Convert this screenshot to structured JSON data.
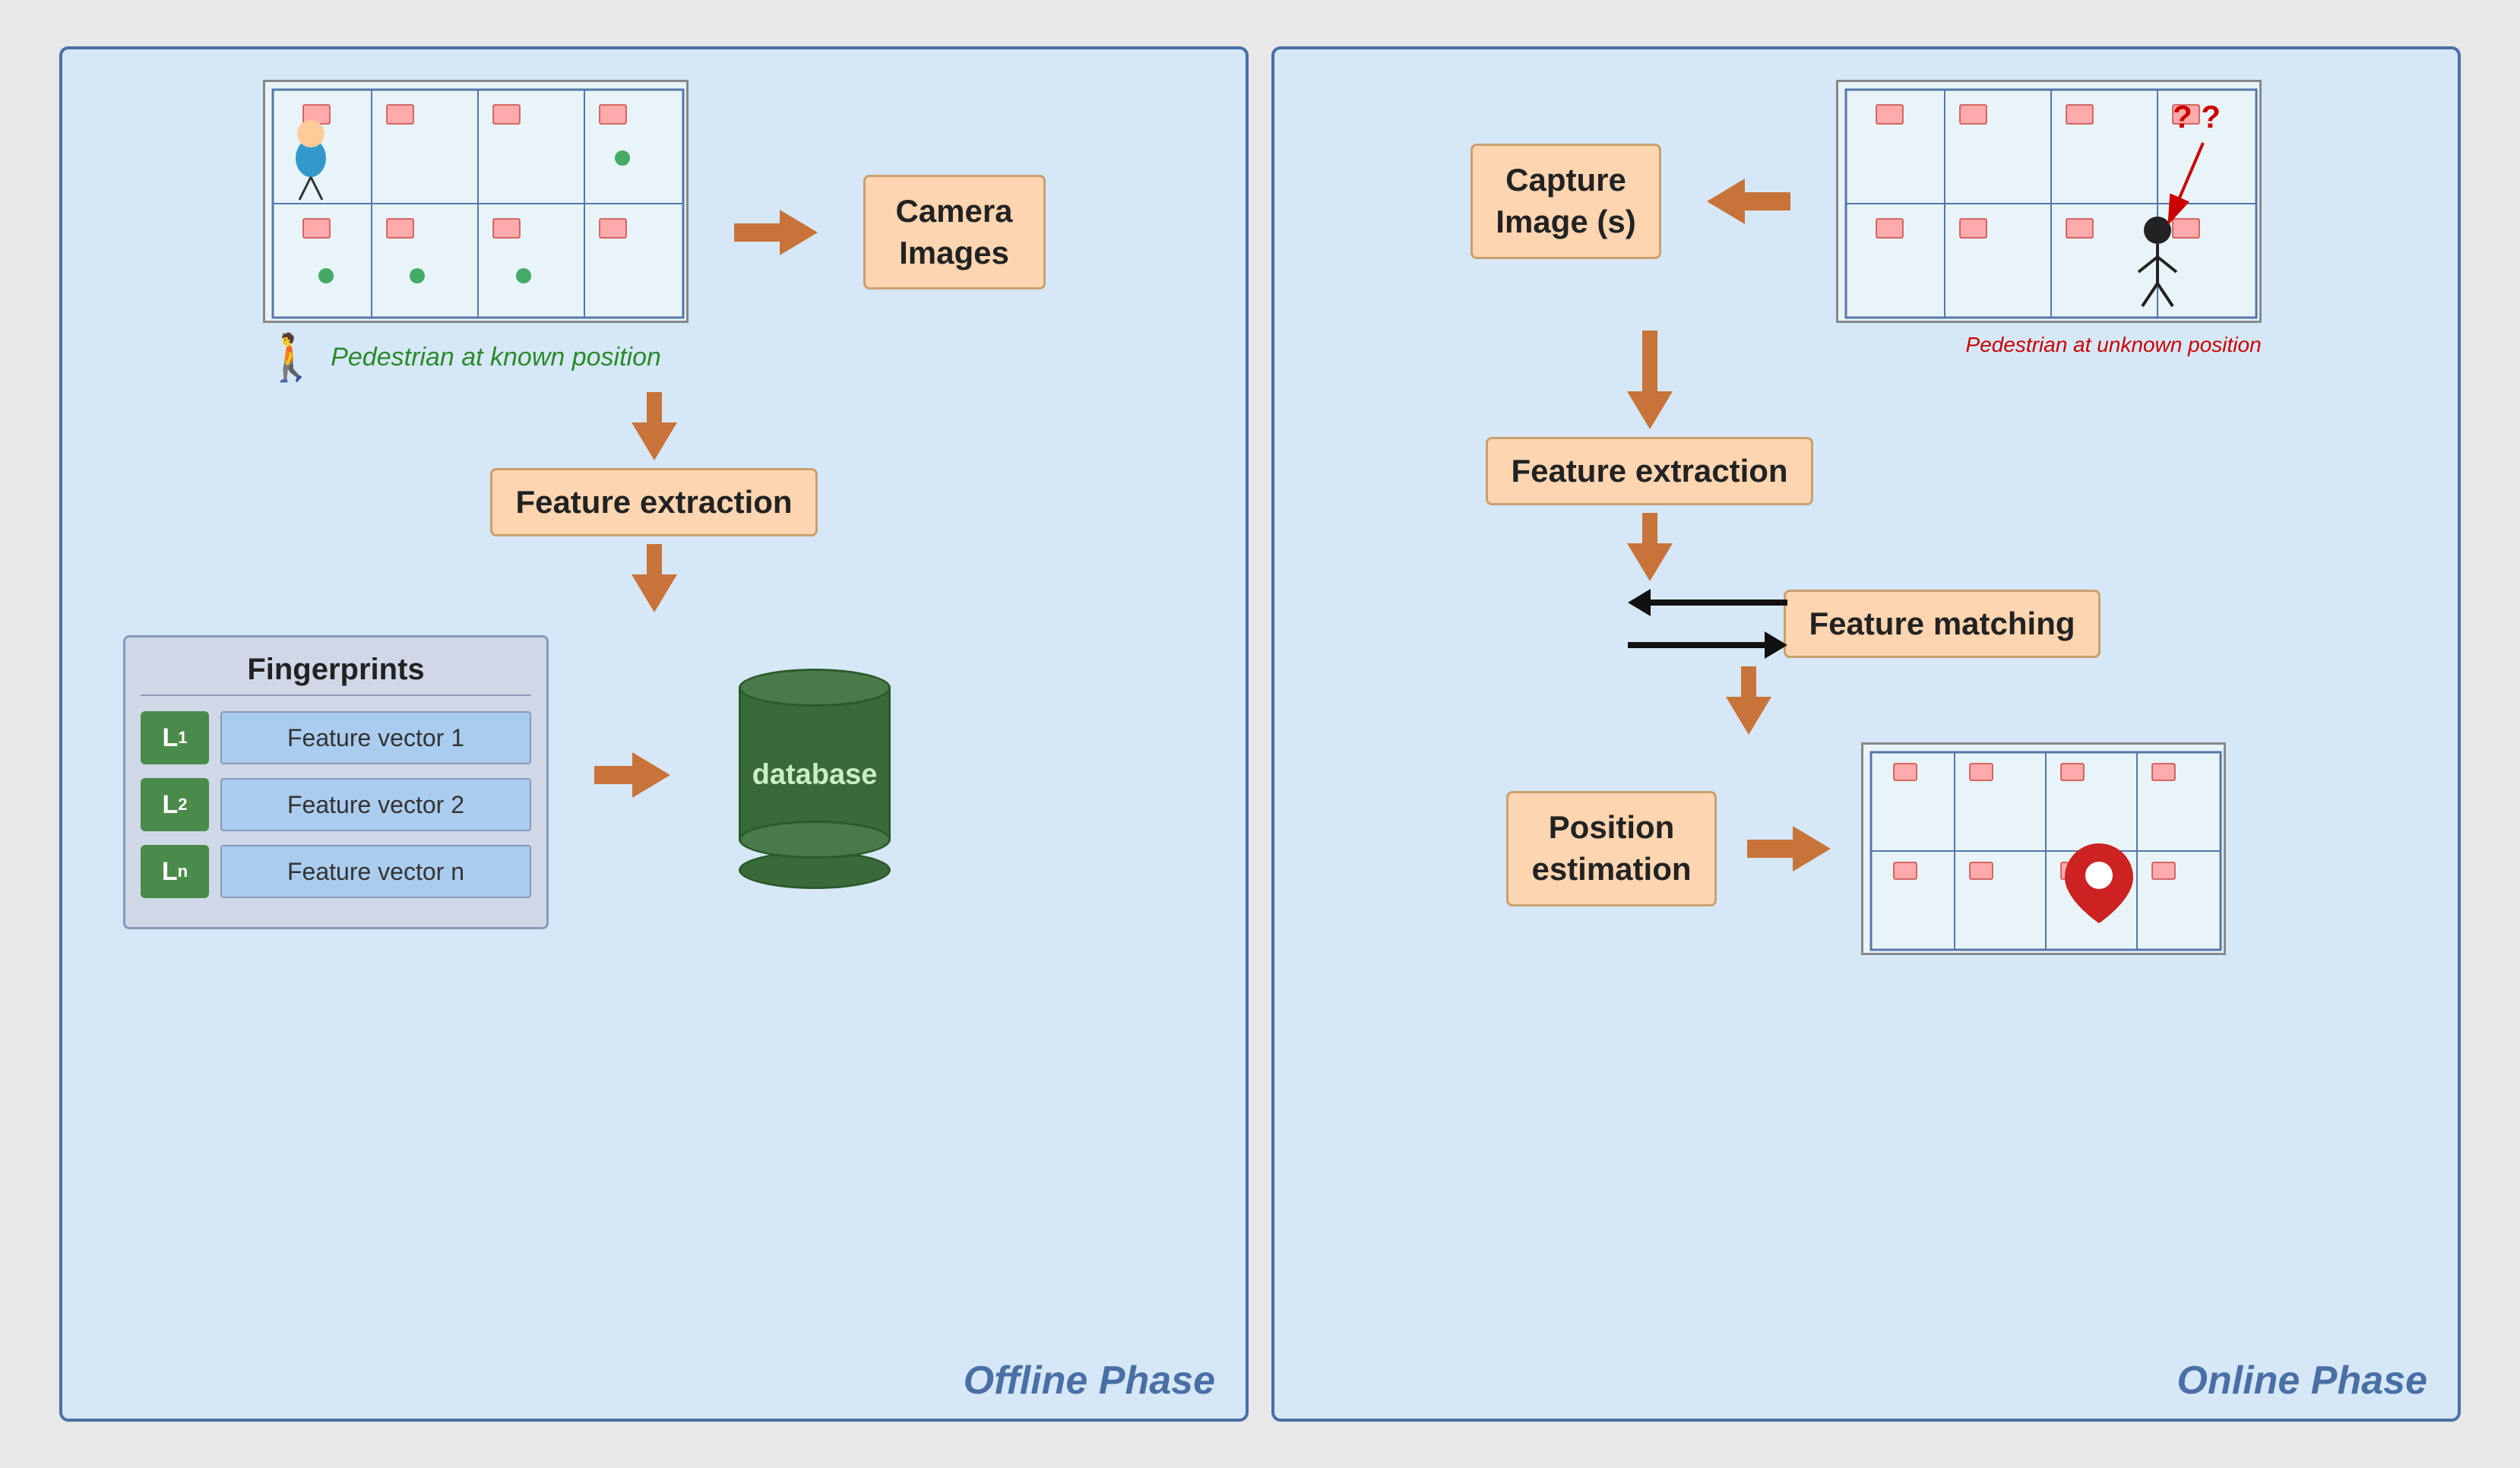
{
  "offline": {
    "phase_label": "Offline Phase",
    "camera_images_label": "Camera\nImages",
    "feature_extraction_label": "Feature extraction",
    "pedestrian_label": "Pedestrian at known position",
    "fingerprints_title": "Fingerprints",
    "database_label": "database",
    "fp_rows": [
      {
        "loc": "L₁",
        "vec": "Feature vector 1"
      },
      {
        "loc": "L₂",
        "vec": "Feature vector 2"
      },
      {
        "loc": "Lₙ",
        "vec": "Feature vector n"
      }
    ]
  },
  "online": {
    "phase_label": "Online Phase",
    "capture_image_label": "Capture\nImage (s)",
    "feature_extraction_label": "Feature extraction",
    "feature_matching_label": "Feature matching",
    "position_estimation_label": "Position\nestimation",
    "pedestrian_label": "Pedestrian at unknown position"
  }
}
